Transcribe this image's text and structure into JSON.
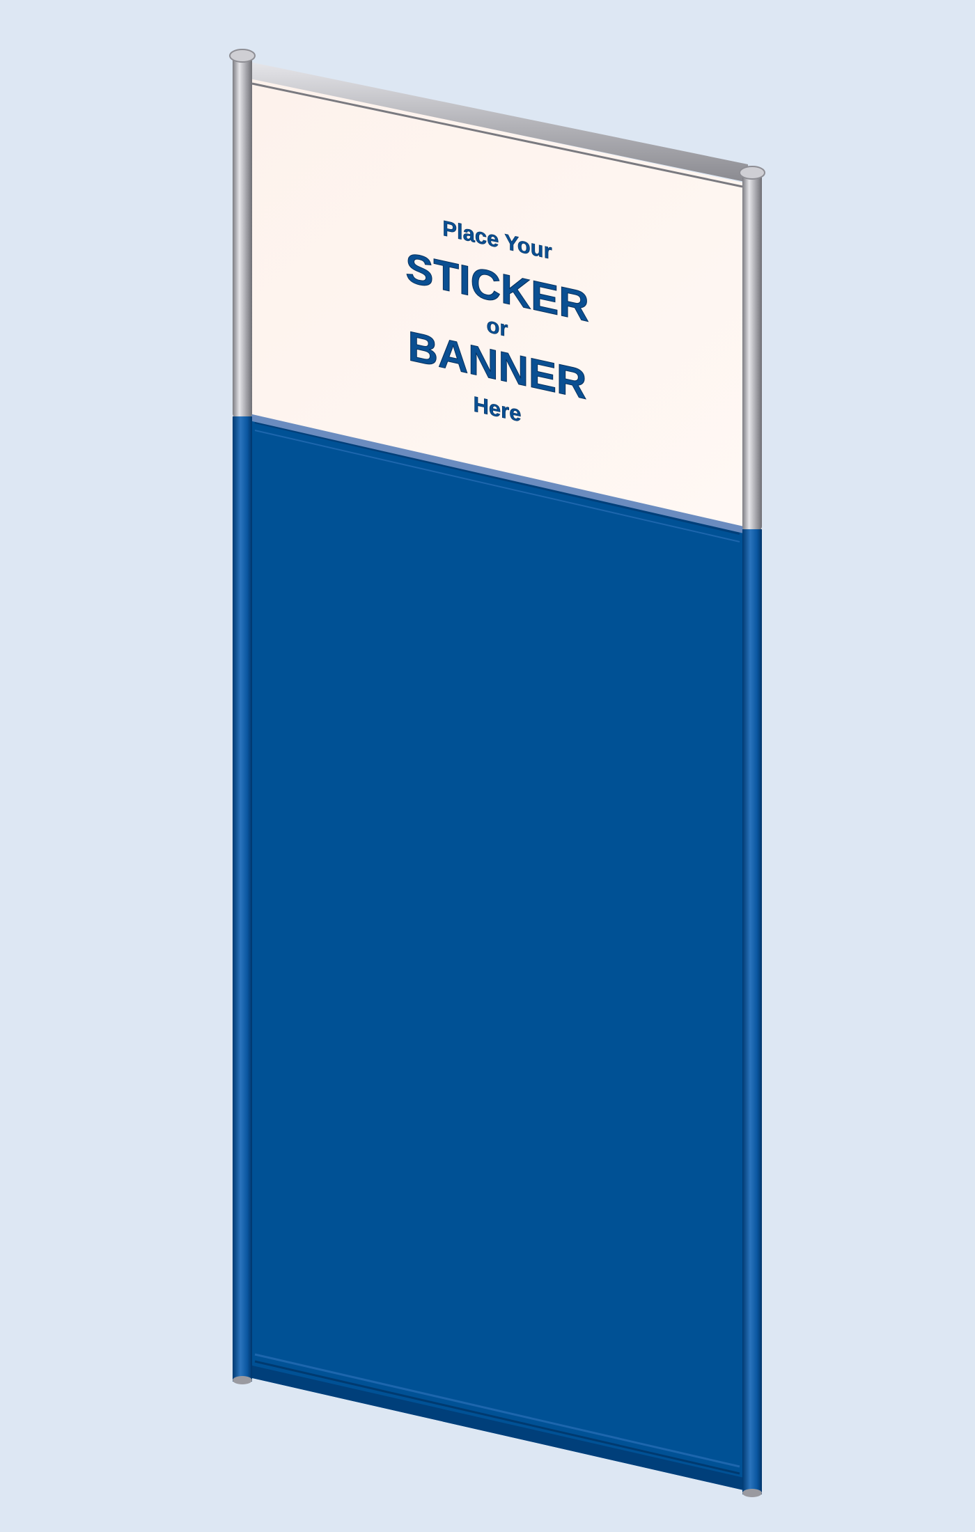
{
  "sign": {
    "line1": "Place Your",
    "line2": "STICKER",
    "line3": "or",
    "line4": "BANNER",
    "line5": "Here"
  },
  "colors": {
    "background": "#dde7f3",
    "panel_blue": "#005195",
    "panel_blue_dark": "#003f7a",
    "panel_blue_light": "#1d66ad",
    "header_cream": "#fff6f1",
    "frame_silver": "#a9a9ad",
    "text_blue": "#0a4f92"
  }
}
